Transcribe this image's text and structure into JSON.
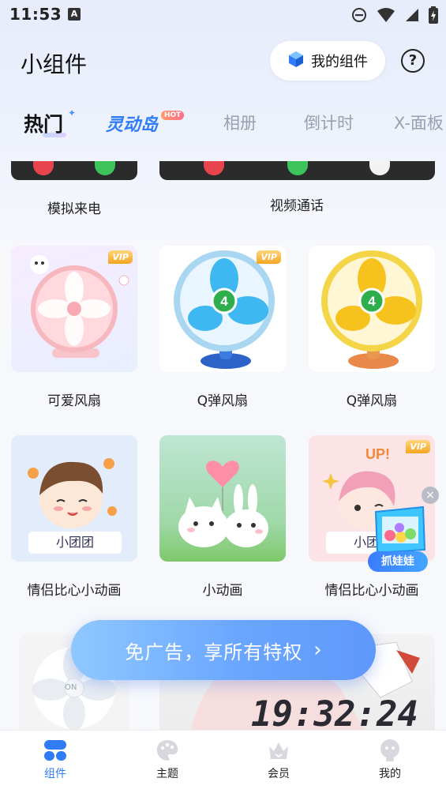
{
  "status_bar": {
    "time": "11:53",
    "notification_icon": "A"
  },
  "header": {
    "title": "小组件",
    "my_widgets_label": "我的组件",
    "help_symbol": "?"
  },
  "tabs": {
    "items": [
      {
        "label": "热门",
        "active": true
      },
      {
        "label": "灵动岛",
        "badge": "HOT"
      },
      {
        "label": "相册"
      },
      {
        "label": "倒计时"
      },
      {
        "label": "X-面板"
      }
    ]
  },
  "widgets": {
    "row0": [
      "模拟来电",
      "视频通话"
    ],
    "row1": [
      {
        "caption": "可爱风扇",
        "vip": "VIP"
      },
      {
        "caption": "Q弹风扇",
        "vip": "VIP",
        "speed": "4"
      },
      {
        "caption": "Q弹风扇",
        "speed": "4"
      }
    ],
    "row2": [
      {
        "caption": "情侣比心小动画",
        "plate": "小团团"
      },
      {
        "caption": "小动画"
      },
      {
        "caption": "情侣比心小动画",
        "vip": "VIP",
        "plate": "小团团",
        "up_text": "UP!"
      }
    ],
    "row3": {
      "fan_switch": "ON",
      "clock": "19:32:24"
    }
  },
  "promo": {
    "label": "免广告，享所有特权",
    "chevron": "›"
  },
  "claw_machine": {
    "label": "抓娃娃",
    "close": "×"
  },
  "bottom_nav": [
    {
      "label": "组件",
      "icon": "widgets-icon",
      "active": true
    },
    {
      "label": "主题",
      "icon": "palette-icon"
    },
    {
      "label": "会员",
      "icon": "crown-icon"
    },
    {
      "label": "我的",
      "icon": "profile-icon"
    }
  ],
  "colors": {
    "accent": "#2f7cf6",
    "vip": "#f5a623"
  }
}
